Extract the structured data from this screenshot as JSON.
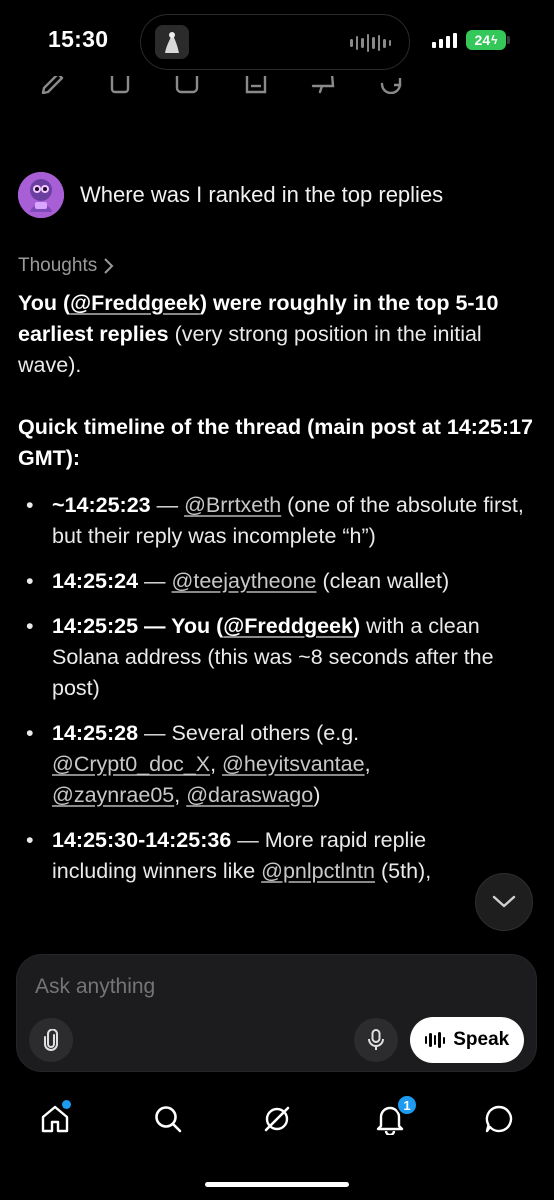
{
  "status_bar": {
    "time": "15:30",
    "battery": "24"
  },
  "query": {
    "text": "Where was I ranked in the top replies"
  },
  "thoughts": {
    "label": "Thoughts"
  },
  "response": {
    "p1_bold_a": "You (",
    "p1_mention": "@Freddgeek",
    "p1_bold_b": ") were roughly in the top 5-10 earliest replies",
    "p1_rest": " (very strong position in the initial wave).",
    "heading": "Quick timeline of the thread (main post at 14:25:17 GMT):",
    "items": [
      {
        "time": "~14:25:23",
        "dash": " — ",
        "mention": "@Brrtxeth",
        "rest": " (one of the absolute first, but their reply was incomplete “h”)"
      },
      {
        "time": "14:25:24",
        "dash": " — ",
        "mention": "@teejaytheone",
        "rest": " (clean wallet)"
      },
      {
        "time": "14:25:25",
        "dash_bold": " — You (",
        "mention": "@Freddgeek",
        "bold_close": ")",
        "rest": " with a clean Solana address (this was ~8 seconds after the post)"
      },
      {
        "time": "14:25:28",
        "dash": " — Several others (e.g. ",
        "mentions": [
          "@Crypt0_doc_X",
          "@heyitsvantae",
          "@zaynrae05",
          "@daraswago"
        ],
        "sep": ", ",
        "close": ")"
      },
      {
        "time": "14:25:30-14:25:36",
        "dash": " — More rapid replie",
        "rest2": "including winners like ",
        "mention": "@pnlpctlntn",
        "rest": " (5th),"
      }
    ]
  },
  "composer": {
    "placeholder": "Ask anything",
    "speak_label": "Speak"
  },
  "nav": {
    "notifications_count": "1"
  },
  "colors": {
    "accent_blue": "#1d9bf0",
    "battery_green": "#34c759",
    "background": "#000000"
  }
}
